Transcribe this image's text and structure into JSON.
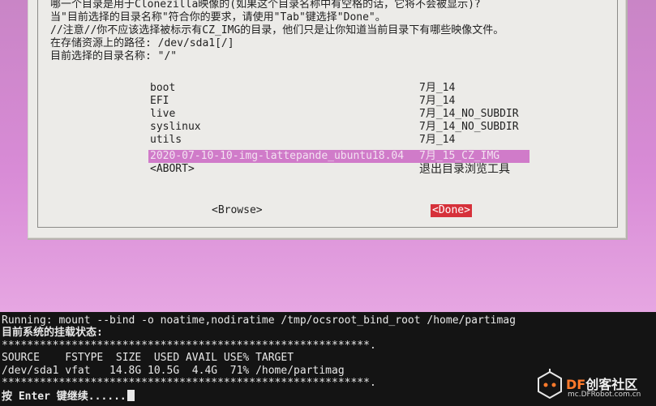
{
  "dialog": {
    "prompt_lines": [
      "哪一个目录是用于Clonezilla映像的(如果这个目录名称中有空格的话，它将不会被显示)?",
      "当\"目前选择的目录名称\"符合你的要求，请使用\"Tab\"键选择\"Done\"。",
      "//注意//你不应该选择被标示有CZ_IMG的目录，他们只是让你知道当前目录下有哪些映像文件。",
      "在存储资源上的路径: /dev/sda1[/]",
      "目前选择的目录名称: \"/\""
    ],
    "files": [
      {
        "name": "boot",
        "date": "7月_14"
      },
      {
        "name": "EFI",
        "date": "7月_14"
      },
      {
        "name": "live",
        "date": "7月_14_NO_SUBDIR"
      },
      {
        "name": "syslinux",
        "date": "7月_14_NO_SUBDIR"
      },
      {
        "name": "utils",
        "date": "7月_14"
      },
      {
        "name": "2020-07-10-10-img-lattepande_ubuntu18.04",
        "date": "7月_15_CZ_IMG"
      },
      {
        "name": "<ABORT>",
        "date": "退出目录浏览工具"
      }
    ],
    "browse_label": "<Browse>",
    "done_label": "<Done>"
  },
  "terminal": {
    "lines": [
      "Running: mount --bind -o noatime,nodiratime /tmp/ocsroot_bind_root /home/partimag",
      "目前系统的挂载状态:",
      "**********************************************************.",
      "SOURCE    FSTYPE  SIZE  USED AVAIL USE% TARGET",
      "/dev/sda1 vfat   14.8G 10.5G  4.4G  71% /home/partimag",
      "**********************************************************.",
      "按 Enter 键继续......"
    ]
  },
  "watermark": {
    "brand_df": "DF",
    "brand_rest": "创客社区",
    "url": "mc.DFRobot.com.cn"
  },
  "colors": {
    "background": "#c985c6",
    "selected_row": "#d07bc9",
    "done_button": "#d6313a",
    "terminal_bg": "#141414"
  }
}
